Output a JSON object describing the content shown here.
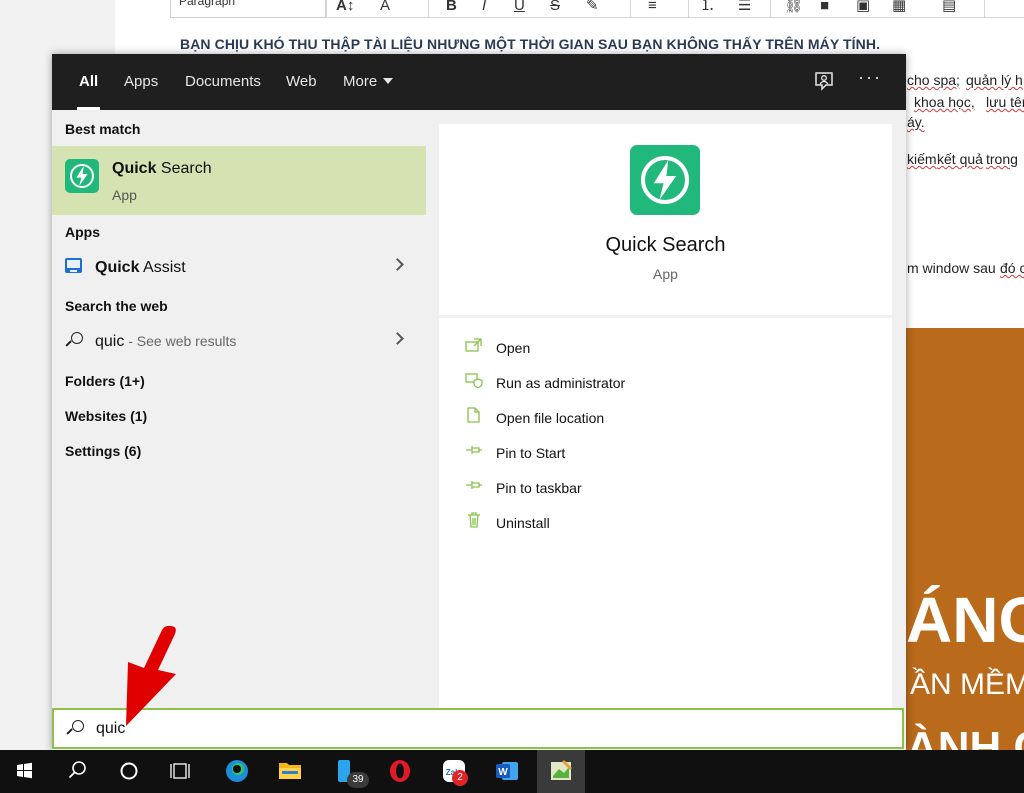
{
  "document": {
    "toolbar_style": "Paragraph",
    "heading": "BẠN CHỊU KHÓ THU THẬP TÀI LIỆU NHƯNG MỘT THỜI GIAN SAU BẠN KHÔNG THẤY TRÊN MÁY TÍNH.",
    "fragments": [
      "cho spa;",
      "quản lý h",
      "khoa học,",
      "lưu tên",
      "áy.",
      "kiếm",
      "kết quả",
      "trong",
      "m window sau",
      "đó c"
    ],
    "banner_lines": [
      "ÁNG",
      "ẦN MỀM",
      "ÀNH C"
    ]
  },
  "search": {
    "tabs": [
      "All",
      "Apps",
      "Documents",
      "Web",
      "More"
    ],
    "active_tab": "All",
    "query": "quic",
    "feedback_icon": "feedback-icon",
    "more_options_label": "···"
  },
  "results": {
    "best_match_header": "Best match",
    "best_match": {
      "name_highlight": "Quick",
      "name_rest": " Search",
      "type": "App",
      "icon": "lightning-bolt-icon"
    },
    "apps_header": "Apps",
    "apps": [
      {
        "name_highlight": "Quick",
        "name_rest": " Assist",
        "icon": "quick-assist-icon"
      }
    ],
    "web_header": "Search the web",
    "web_result": {
      "query": "quic",
      "suffix": " - See web results"
    },
    "categories": [
      "Folders (1+)",
      "Websites (1)",
      "Settings (6)"
    ]
  },
  "detail": {
    "name": "Quick Search",
    "type": "App",
    "actions": [
      {
        "label": "Open",
        "icon": "open-icon"
      },
      {
        "label": "Run as administrator",
        "icon": "shield-icon"
      },
      {
        "label": "Open file location",
        "icon": "file-location-icon"
      },
      {
        "label": "Pin to Start",
        "icon": "pin-icon"
      },
      {
        "label": "Pin to taskbar",
        "icon": "pin-icon"
      },
      {
        "label": "Uninstall",
        "icon": "trash-icon"
      }
    ]
  },
  "taskbar": {
    "items": [
      "windows-start",
      "search",
      "cortana",
      "task-view",
      "edge",
      "file-explorer",
      "phone-app",
      "opera",
      "zalo",
      "word",
      "quick-search"
    ],
    "phone_badge": "39",
    "zalo_badge": "2"
  },
  "colors": {
    "accent_green": "#8bc34a",
    "tile_green": "#21b87b",
    "best_match_bg": "#d4e3b1",
    "topbar": "#1f1f1f"
  }
}
